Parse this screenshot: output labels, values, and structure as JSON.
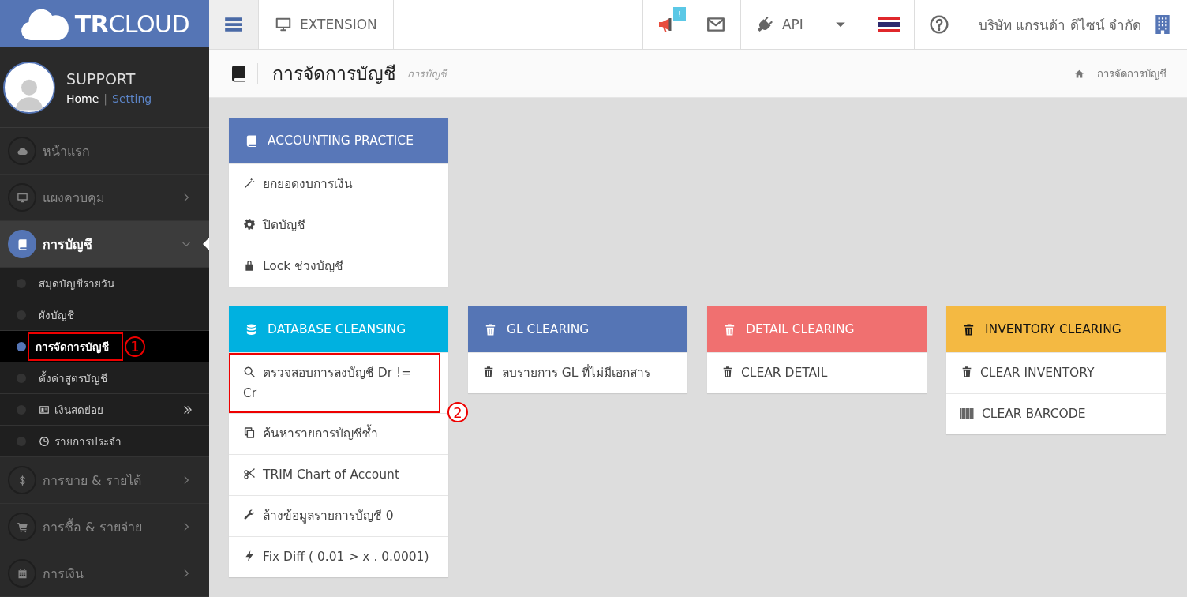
{
  "brand": {
    "logo": "**TR**CLOUD"
  },
  "topbar": {
    "extension": "EXTENSION",
    "notification_badge": "!",
    "api": "API",
    "company": "บริษัท แกรนด้า ดีไซน์ จำกัด"
  },
  "profile": {
    "name": "SUPPORT",
    "links": [
      {
        "label": "Home",
        "selected": true
      },
      {
        "label": "Setting",
        "selected": false
      }
    ],
    "separator": "|"
  },
  "sidebar": {
    "items": [
      {
        "label": "หน้าแรก",
        "kind": "cloud",
        "selected": false
      },
      {
        "label": "แผงควบคุม",
        "kind": "monitor",
        "expanded": false,
        "selected": false
      },
      {
        "label": "การบัญชี",
        "kind": "book",
        "expanded": true,
        "selected": true,
        "children": [
          {
            "label": "สมุดบัญชีรายวัน",
            "kind": "none",
            "submenu": false,
            "selected": false
          },
          {
            "label": "ผังบัญชี",
            "kind": "none",
            "submenu": false,
            "selected": false
          },
          {
            "label": "การจัดการบัญชี",
            "kind": "none",
            "submenu": false,
            "selected": true,
            "annotation": "1"
          },
          {
            "label": "ตั้งค่าสูตรบัญชี",
            "kind": "none",
            "submenu": false,
            "selected": false
          },
          {
            "label": "เงินสดย่อย",
            "kind": "idcard",
            "submenu": true,
            "selected": false
          },
          {
            "label": "รายการประจำ",
            "kind": "clock",
            "submenu": false,
            "selected": false
          }
        ]
      },
      {
        "label": "การขาย & รายได้",
        "kind": "dollar",
        "expanded": false,
        "selected": false
      },
      {
        "label": "การซื้อ & รายจ่าย",
        "kind": "cart",
        "expanded": false,
        "selected": false
      },
      {
        "label": "การเงิน",
        "kind": "calendar",
        "expanded": false,
        "selected": false
      }
    ]
  },
  "page_header": {
    "title": "การจัดการบัญชี",
    "subtitle": "การบัญชี",
    "breadcrumb": "การจัดการบัญชี"
  },
  "card_rows": [
    [
      {
        "title": "ACCOUNTING PRACTICE",
        "kind": "book",
        "color": "#5877b8",
        "items": [
          {
            "label": "ยกยอดงบการเงิน",
            "kind": "wand"
          },
          {
            "label": "ปิดบัญชี",
            "kind": "gear"
          },
          {
            "label": "Lock ช่วงบัญชี",
            "kind": "lock"
          }
        ]
      }
    ],
    [
      {
        "title": "DATABASE CLEANSING",
        "kind": "database",
        "color": "#00b1e0",
        "items": [
          {
            "label": "ตรวจสอบการลงบัญชี Dr != Cr",
            "kind": "search",
            "annotation": "2"
          },
          {
            "label": "ค้นหารายการบัญชีซ้ำ",
            "kind": "copy"
          },
          {
            "label": "TRIM Chart of Account",
            "kind": "scissors"
          },
          {
            "label": "ล้างข้อมูลรายการบัญชี 0",
            "kind": "wrench"
          },
          {
            "label": "Fix Diff ( 0.01 > x . 0.0001)",
            "kind": "bolt"
          }
        ]
      },
      {
        "title": "GL CLEARING",
        "kind": "trash",
        "color": "#5575b5",
        "items": [
          {
            "label": "ลบรายการ GL ที่ไม่มีเอกสาร",
            "kind": "trash"
          }
        ]
      },
      {
        "title": "DETAIL CLEARING",
        "kind": "trash",
        "color": "#f07070",
        "items": [
          {
            "label": "CLEAR DETAIL",
            "kind": "trash"
          }
        ]
      },
      {
        "title": "INVENTORY CLEARING",
        "kind": "trash",
        "color": "#f4b942",
        "items": [
          {
            "label": "CLEAR INVENTORY",
            "kind": "trash"
          },
          {
            "label": "CLEAR BARCODE",
            "kind": "barcode"
          }
        ]
      }
    ]
  ]
}
